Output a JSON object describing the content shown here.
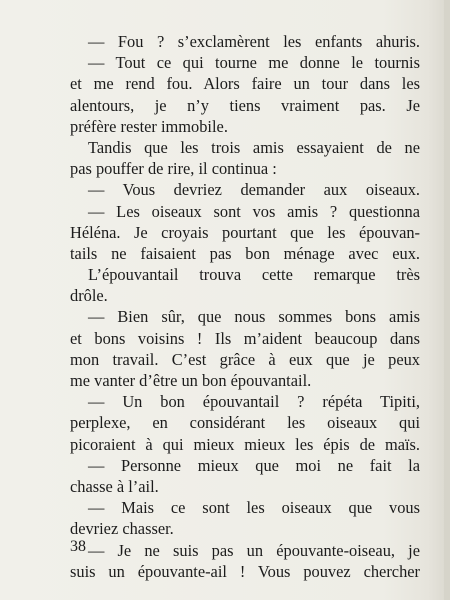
{
  "lines": [
    {
      "text": "— Fou ? s’exclamèrent les enfants ahuris.",
      "indent": true,
      "last": false
    },
    {
      "text": "— Tout ce qui tourne me donne le tournis",
      "indent": true,
      "last": false
    },
    {
      "text": "et me rend fou. Alors faire un tour dans les",
      "indent": false,
      "last": false
    },
    {
      "text": "alentours, je n’y tiens vraiment pas. Je",
      "indent": false,
      "last": false
    },
    {
      "text": "préfère rester immobile.",
      "indent": false,
      "last": true
    },
    {
      "text": "Tandis que les trois amis essayaient de ne",
      "indent": true,
      "last": false
    },
    {
      "text": "pas pouffer de rire, il continua :",
      "indent": false,
      "last": true
    },
    {
      "text": "— Vous devriez demander aux oiseaux.",
      "indent": true,
      "last": false
    },
    {
      "text": "— Les oiseaux sont vos amis ? questionna",
      "indent": true,
      "last": false
    },
    {
      "text": "Héléna. Je croyais pourtant que les épouvan-",
      "indent": false,
      "last": false
    },
    {
      "text": "tails ne faisaient pas bon ménage avec eux.",
      "indent": false,
      "last": false
    },
    {
      "text": "L’épouvantail trouva cette remarque très",
      "indent": true,
      "last": false
    },
    {
      "text": "drôle.",
      "indent": false,
      "last": true
    },
    {
      "text": "— Bien sûr, que nous sommes bons amis",
      "indent": true,
      "last": false
    },
    {
      "text": "et bons voisins ! Ils m’aident beaucoup dans",
      "indent": false,
      "last": false
    },
    {
      "text": "mon travail. C’est grâce à eux que je peux",
      "indent": false,
      "last": false
    },
    {
      "text": "me vanter d’être un bon épouvantail.",
      "indent": false,
      "last": true
    },
    {
      "text": "— Un bon épouvantail ? répéta Tipiti,",
      "indent": true,
      "last": false
    },
    {
      "text": "perplexe, en considérant les oiseaux qui",
      "indent": false,
      "last": false
    },
    {
      "text": "picoraient à qui mieux mieux les épis de maïs.",
      "indent": false,
      "last": false
    },
    {
      "text": "— Personne mieux que moi ne fait la",
      "indent": true,
      "last": false
    },
    {
      "text": "chasse à l’ail.",
      "indent": false,
      "last": true
    },
    {
      "text": "— Mais ce sont les oiseaux que vous",
      "indent": true,
      "last": false
    },
    {
      "text": "devriez chasser.",
      "indent": false,
      "last": true
    },
    {
      "text": "— Je ne suis pas un épouvante-oiseau, je",
      "indent": true,
      "last": false
    },
    {
      "text": "suis un épouvante-ail ! Vous pouvez chercher",
      "indent": false,
      "last": false
    }
  ],
  "page_number": "38"
}
